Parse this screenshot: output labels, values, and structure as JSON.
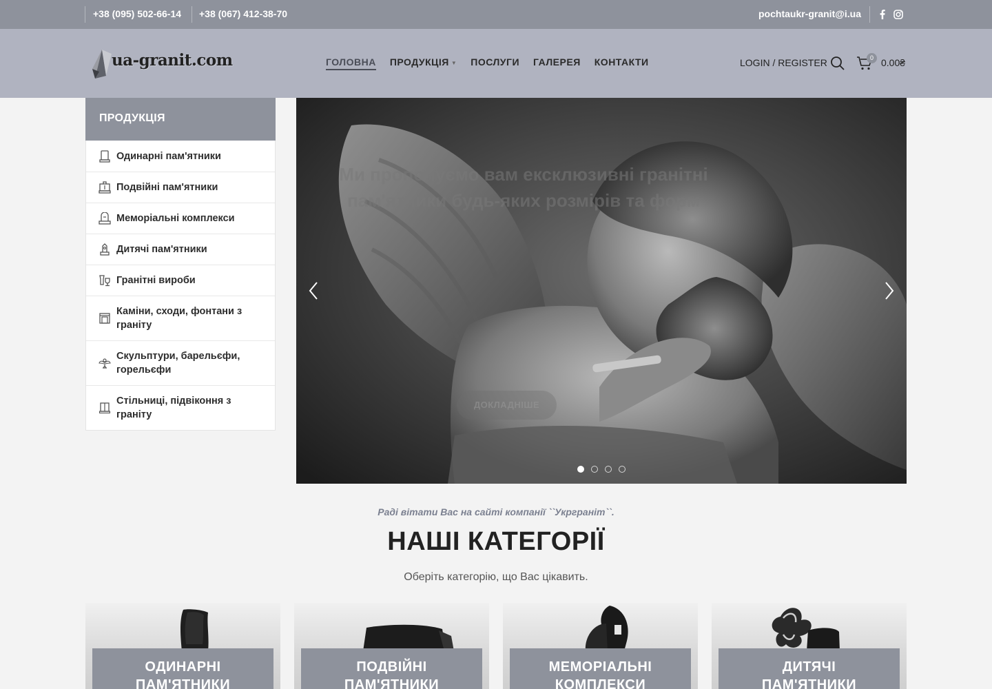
{
  "topbar": {
    "phone1": "+38 (095) 502-66-14",
    "phone2": "+38 (067) 412-38-70",
    "email": "pochtaukr-granit@i.ua",
    "social": [
      "facebook-icon",
      "instagram-icon"
    ]
  },
  "header": {
    "logo_text": "ua-granit.com",
    "nav": [
      {
        "label": "ГОЛОВНА",
        "active": true
      },
      {
        "label": "ПРОДУКЦІЯ",
        "has_dropdown": true
      },
      {
        "label": "ПОСЛУГИ"
      },
      {
        "label": "ГАЛЕРЕЯ"
      },
      {
        "label": "КОНТАКТИ"
      }
    ],
    "login_label": "LOGIN / REGISTER",
    "cart_count": "0",
    "cart_total": "0.00₴"
  },
  "sidebar": {
    "title": "ПРОДУКЦІЯ",
    "items": [
      {
        "label": "Одинарні пам'ятники",
        "icon": "single-monument-icon"
      },
      {
        "label": "Подвійні пам'ятники",
        "icon": "double-monument-icon"
      },
      {
        "label": "Меморіальні комплекси",
        "icon": "memorial-complex-icon"
      },
      {
        "label": "Дитячі пам'ятники",
        "icon": "child-monument-icon"
      },
      {
        "label": "Гранітні вироби",
        "icon": "granite-vase-icon"
      },
      {
        "label": "Каміни, сходи, фонтани з граніту",
        "icon": "fireplace-icon"
      },
      {
        "label": "Скульптури, барельєфи, горельєфи",
        "icon": "angel-sculpture-icon"
      },
      {
        "label": "Стільниці, підвіконня з граніту",
        "icon": "window-sill-icon"
      }
    ]
  },
  "slider": {
    "text": "Ми пропонуємо вам ексклюзивні гранітні пам'ятники будь-яких розмірів та форм",
    "button_label": "ДОКЛАДНІШЕ",
    "slides_count": 4,
    "active_slide": 1
  },
  "intro": {
    "welcome": "Раді вітати Вас на сайті компанії ``Укрграніт``.",
    "title": "НАШІ КАТЕГОРІЇ",
    "subtitle": "Оберіть категорію, що Вас цікавить."
  },
  "categories": [
    {
      "line1": "ОДИНАРНІ",
      "line2": "ПАМ'ЯТНИКИ"
    },
    {
      "line1": "ПОДВІЙНІ",
      "line2": "ПАМ'ЯТНИКИ"
    },
    {
      "line1": "МЕМОРІАЛЬНІ",
      "line2": "КОМПЛЕКСИ"
    },
    {
      "line1": "ДИТЯЧІ",
      "line2": "ПАМ'ЯТНИКИ"
    }
  ],
  "colors": {
    "topbar_bg": "#8e929c",
    "header_bg": "#b0b3c0",
    "page_bg": "#f3f3f3",
    "label_bg": "#8e929c"
  }
}
